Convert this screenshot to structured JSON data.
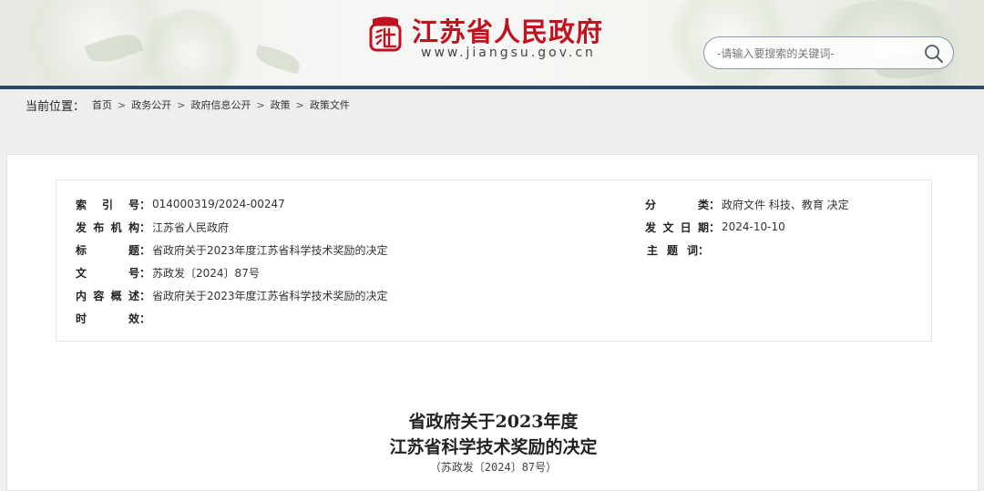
{
  "header": {
    "site_title": "江苏省人民政府",
    "site_domain": "www.jiangsu.gov.cn",
    "search_placeholder": "-请输入要搜索的关键词-",
    "brand_color": "#c1121f",
    "header_line_color": "#2e4a6b"
  },
  "breadcrumb": {
    "label": "当前位置：",
    "items": [
      "首页",
      "政务公开",
      "政府信息公开",
      "政策",
      "政策文件"
    ],
    "separator": ">"
  },
  "meta": {
    "left": [
      {
        "label": "索引号",
        "value": "014000319/2024-00247"
      },
      {
        "label": "发布机构",
        "value": "江苏省人民政府"
      },
      {
        "label": "标题",
        "value": "省政府关于2023年度江苏省科学技术奖励的决定"
      },
      {
        "label": "文号",
        "value": "苏政发〔2024〕87号"
      },
      {
        "label": "内容概述",
        "value": "省政府关于2023年度江苏省科学技术奖励的决定"
      },
      {
        "label": "时效",
        "value": ""
      }
    ],
    "right": [
      {
        "label": "分类",
        "value": "政府文件 科技、教育 决定"
      },
      {
        "label": "发文日期",
        "value": "2024-10-10"
      },
      {
        "label": "主题词",
        "value": ""
      }
    ]
  },
  "document": {
    "title_line1": "省政府关于2023年度",
    "title_line2": "江苏省科学技术奖励的决定",
    "doc_number": "（苏政发〔2024〕87号）"
  },
  "icons": {
    "logo": "jiangsu-emblem-icon",
    "search": "search-icon"
  }
}
